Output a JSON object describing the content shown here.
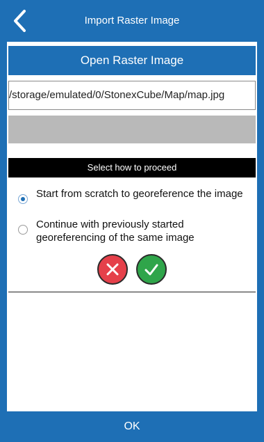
{
  "header": {
    "title": "Import Raster Image",
    "back_icon": "chevron-left-icon"
  },
  "open_button": {
    "label": "Open Raster Image"
  },
  "file_path": {
    "value": "/storage/emulated/0/StonexCube/Map/map.jpg"
  },
  "dialog": {
    "title": "Select how to proceed",
    "options": [
      {
        "label": "Start from scratch to georeference the image",
        "selected": true
      },
      {
        "label": "Continue with previously started georeferencing of the same image",
        "selected": false
      }
    ],
    "cancel_icon": "close-circle-icon",
    "confirm_icon": "check-circle-icon"
  },
  "footer": {
    "ok_label": "OK"
  },
  "colors": {
    "accent": "#1e6fb5",
    "cancel": "#e5404a",
    "confirm": "#2fa54a"
  }
}
